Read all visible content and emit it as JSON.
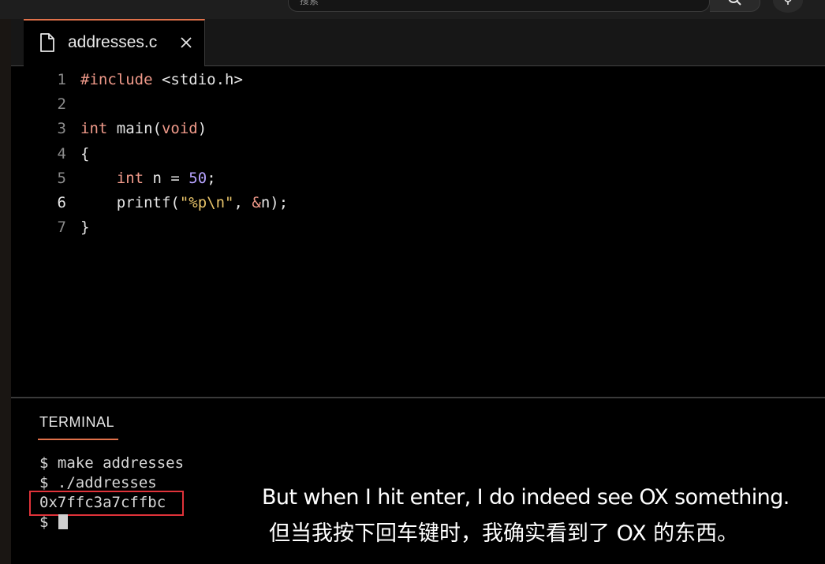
{
  "search": {
    "placeholder_text": "搜索"
  },
  "tab": {
    "filename": "addresses.c",
    "file_icon": "file-icon",
    "close_icon": "close-icon"
  },
  "editor": {
    "active_line": 6,
    "lines": [
      {
        "n": "1",
        "tokens": [
          {
            "t": "#include ",
            "c": "pp"
          },
          {
            "t": "<stdio.h>",
            "c": "hdr"
          }
        ]
      },
      {
        "n": "2",
        "tokens": []
      },
      {
        "n": "3",
        "tokens": [
          {
            "t": "int",
            "c": "kw"
          },
          {
            "t": " main(",
            "c": "fn"
          },
          {
            "t": "void",
            "c": "kw"
          },
          {
            "t": ")",
            "c": "punct"
          }
        ]
      },
      {
        "n": "4",
        "tokens": [
          {
            "t": "{",
            "c": "punct"
          }
        ]
      },
      {
        "n": "5",
        "tokens": [
          {
            "t": "    ",
            "c": "punct"
          },
          {
            "t": "int",
            "c": "kw"
          },
          {
            "t": " n = ",
            "c": "fn"
          },
          {
            "t": "50",
            "c": "num"
          },
          {
            "t": ";",
            "c": "punct"
          }
        ]
      },
      {
        "n": "6",
        "tokens": [
          {
            "t": "    printf(",
            "c": "fn"
          },
          {
            "t": "\"%p\\n\"",
            "c": "str"
          },
          {
            "t": ", ",
            "c": "punct"
          },
          {
            "t": "&",
            "c": "kw"
          },
          {
            "t": "n);",
            "c": "fn"
          }
        ]
      },
      {
        "n": "7",
        "tokens": [
          {
            "t": "}",
            "c": "punct"
          }
        ]
      }
    ]
  },
  "terminal": {
    "tab_label": "TERMINAL",
    "lines": [
      "$ make addresses",
      "$ ./addresses",
      "0x7ffc3a7cffbc",
      "$ "
    ]
  },
  "subtitles": {
    "english": "But when I hit enter, I do indeed see OX something.",
    "chinese": "但当我按下回车键时，我确实看到了 OX 的东西。"
  },
  "colors": {
    "accent": "#e0714a",
    "highlight_box": "#e0333a",
    "keyword": "#f09a8a",
    "string": "#e8c46a",
    "number": "#b6a3ff"
  }
}
